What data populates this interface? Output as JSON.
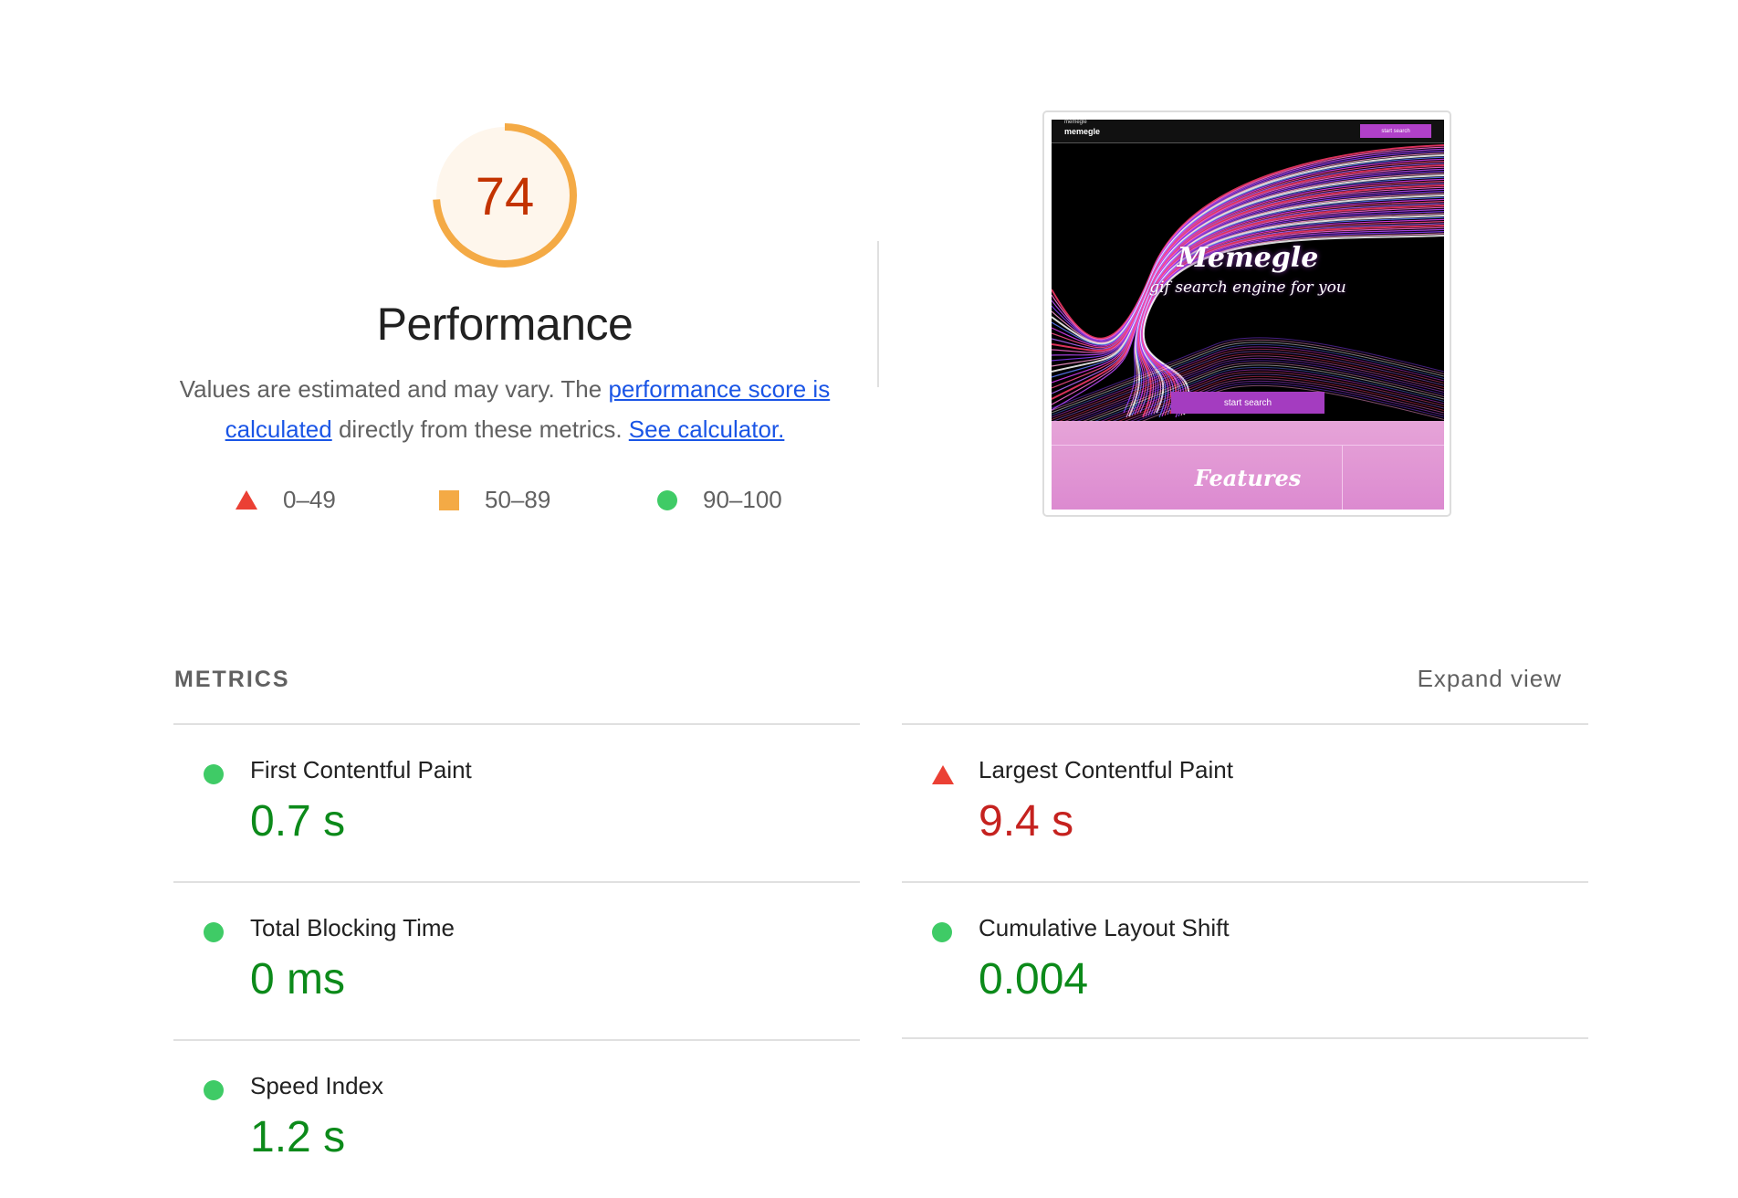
{
  "score": {
    "value": "74",
    "fraction": 0.74,
    "color": "#f4aa45",
    "text_color": "#c33300"
  },
  "category": {
    "title": "Performance",
    "desc_prefix": "Values are estimated and may vary. The ",
    "link1": "performance score is calculated",
    "desc_middle": " directly from these metrics. ",
    "link2": "See calculator."
  },
  "legend": [
    {
      "range": "0–49",
      "icon": "triangle-red"
    },
    {
      "range": "50–89",
      "icon": "square-orange"
    },
    {
      "range": "90–100",
      "icon": "circle-green"
    }
  ],
  "thumbnail": {
    "logo_small": "memegle",
    "logo": "memegle",
    "top_button": "start search",
    "title": "Memegle",
    "subtitle": "gif search engine for you",
    "button": "start search",
    "features": "Features"
  },
  "metrics": {
    "header": "METRICS",
    "expand": "Expand view",
    "items": [
      {
        "title": "First Contentful Paint",
        "value": "0.7 s",
        "status": "pass"
      },
      {
        "title": "Largest Contentful Paint",
        "value": "9.4 s",
        "status": "fail"
      },
      {
        "title": "Total Blocking Time",
        "value": "0 ms",
        "status": "pass"
      },
      {
        "title": "Cumulative Layout Shift",
        "value": "0.004",
        "status": "pass"
      },
      {
        "title": "Speed Index",
        "value": "1.2 s",
        "status": "pass"
      }
    ]
  },
  "colors": {
    "pass": "#0c8a1a",
    "fail": "#c5221f",
    "average": "#f4aa45",
    "link": "#1a55e6"
  }
}
